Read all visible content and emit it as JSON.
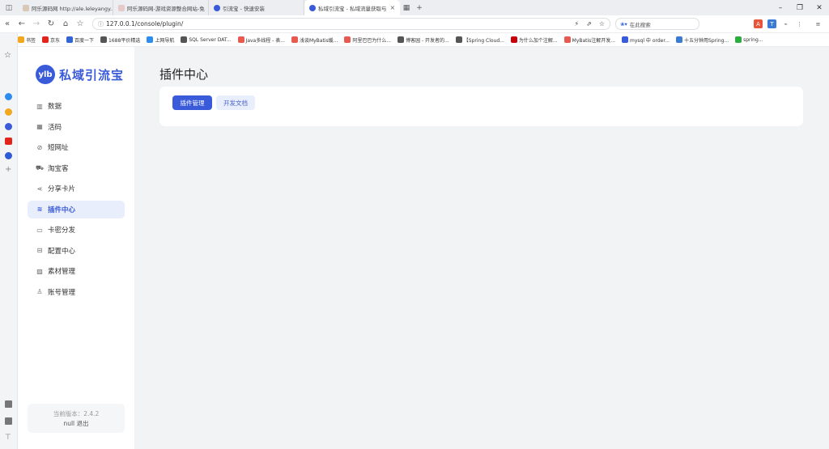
{
  "browser": {
    "tabs": [
      {
        "label": "阿乐源码网 http://ale.leleyangy...",
        "active": false
      },
      {
        "label": "阿乐源码网-游戏资源整合网站-免",
        "active": false
      },
      {
        "label": "引流宝 - 快速安装",
        "active": false
      },
      {
        "label": "私域引流宝 - 私域流量获取与",
        "active": true
      }
    ],
    "url": "127.0.0.1/console/plugin/",
    "search_placeholder": "在此搜索",
    "bookmarks": [
      {
        "label": "书签",
        "color": "#f2a81d"
      },
      {
        "label": "京东",
        "color": "#e1251b"
      },
      {
        "label": "百度一下",
        "color": "#3165d4"
      },
      {
        "label": "1688平价精选",
        "color": "#555555"
      },
      {
        "label": "上网导航",
        "color": "#2d8cf0"
      },
      {
        "label": "SQL Server DAT...",
        "color": "#555555"
      },
      {
        "label": "Java多线程 - 表...",
        "color": "#e85a4f"
      },
      {
        "label": "浅谈MyBatis缓...",
        "color": "#e85a4f"
      },
      {
        "label": "阿里巴巴为什么...",
        "color": "#e85a4f"
      },
      {
        "label": "博客园 - 开发者的...",
        "color": "#555555"
      },
      {
        "label": "【Spring Cloud...",
        "color": "#555555"
      },
      {
        "label": "为什么加个注解...",
        "color": "#c7000b"
      },
      {
        "label": "MyBatis注解开发...",
        "color": "#e85a4f"
      },
      {
        "label": "mysql 中 order...",
        "color": "#3a5bd9"
      },
      {
        "label": "十五分钟用Spring...",
        "color": "#3a7bd5"
      },
      {
        "label": "spring...",
        "color": "#2bae3f"
      }
    ]
  },
  "app": {
    "logo_mark": "ylb",
    "logo_name": "私域引流宝",
    "menu": [
      {
        "label": "数据",
        "icon": "chart-icon",
        "glyph": "▥",
        "active": false
      },
      {
        "label": "活码",
        "icon": "qrcode-icon",
        "glyph": "▦",
        "active": false
      },
      {
        "label": "短网址",
        "icon": "link-icon",
        "glyph": "⊘",
        "active": false
      },
      {
        "label": "淘宝客",
        "icon": "cart-icon",
        "glyph": "⛟",
        "active": false
      },
      {
        "label": "分享卡片",
        "icon": "share-icon",
        "glyph": "⋖",
        "active": false
      },
      {
        "label": "插件中心",
        "icon": "layers-icon",
        "glyph": "≋",
        "active": true
      },
      {
        "label": "卡密分发",
        "icon": "card-icon",
        "glyph": "▭",
        "active": false
      },
      {
        "label": "配置中心",
        "icon": "config-icon",
        "glyph": "⊟",
        "active": false
      },
      {
        "label": "素材管理",
        "icon": "image-icon",
        "glyph": "▨",
        "active": false
      },
      {
        "label": "账号管理",
        "icon": "user-icon",
        "glyph": "♙",
        "active": false
      }
    ],
    "version_text": "当前版本：2.4.2",
    "user_name": "null",
    "logout_label": "退出"
  },
  "main": {
    "page_title": "插件中心",
    "tabs": [
      {
        "label": "插件管理",
        "active": true
      },
      {
        "label": "开发文档",
        "active": false
      }
    ]
  }
}
